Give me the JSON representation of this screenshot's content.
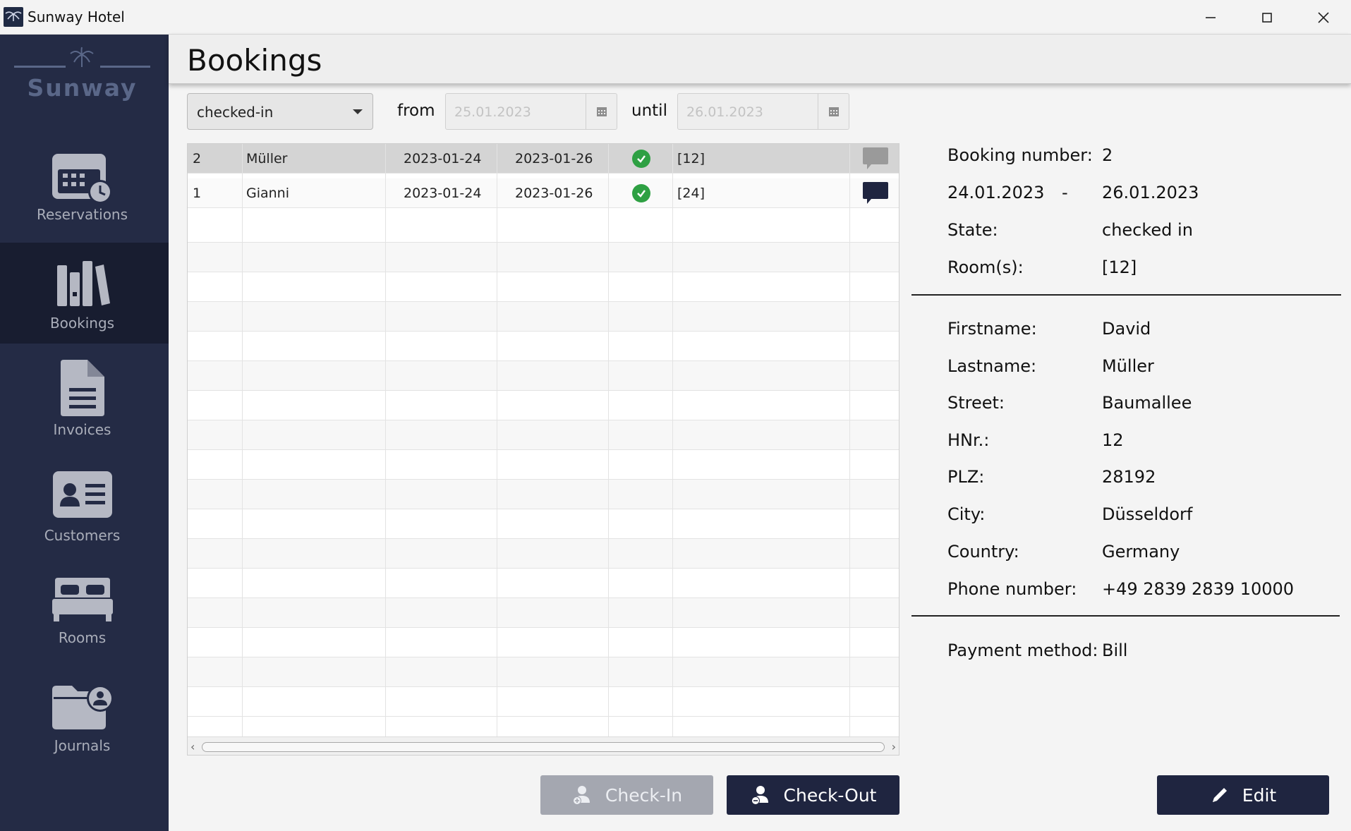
{
  "window": {
    "title": "Sunway Hotel",
    "controls": [
      "minimize",
      "maximize",
      "close"
    ]
  },
  "brand": {
    "name": "Sunway"
  },
  "sidebar": {
    "items": [
      {
        "label": "Reservations",
        "icon": "calendar-clock-icon",
        "active": false
      },
      {
        "label": "Bookings",
        "icon": "books-icon",
        "active": true
      },
      {
        "label": "Invoices",
        "icon": "document-icon",
        "active": false
      },
      {
        "label": "Customers",
        "icon": "id-card-icon",
        "active": false
      },
      {
        "label": "Rooms",
        "icon": "bed-icon",
        "active": false
      },
      {
        "label": "Journals",
        "icon": "folder-user-icon",
        "active": false
      }
    ]
  },
  "header": {
    "title": "Bookings"
  },
  "filters": {
    "state": "checked-in",
    "from_label": "from",
    "from_value": "25.01.2023",
    "until_label": "until",
    "until_value": "26.01.2023"
  },
  "table": {
    "rows": [
      {
        "id": "2",
        "name": "Müller",
        "from": "2023-01-24",
        "until": "2023-01-26",
        "checked": true,
        "rooms": "[12]",
        "comment": "light",
        "selected": true
      },
      {
        "id": "1",
        "name": "Gianni",
        "from": "2023-01-24",
        "until": "2023-01-26",
        "checked": true,
        "rooms": "[24]",
        "comment": "dark",
        "selected": false
      }
    ]
  },
  "details": {
    "booking_number_label": "Booking number:",
    "booking_number": "2",
    "date_from": "24.01.2023",
    "date_dash": "-",
    "date_until": "26.01.2023",
    "state_label": "State:",
    "state": "checked in",
    "rooms_label": "Room(s):",
    "rooms": "[12]",
    "firstname_label": "Firstname:",
    "firstname": "David",
    "lastname_label": "Lastname:",
    "lastname": "Müller",
    "street_label": "Street:",
    "street": "Baumallee",
    "hnr_label": "HNr.:",
    "hnr": "12",
    "plz_label": "PLZ:",
    "plz": "28192",
    "city_label": "City:",
    "city": "Düsseldorf",
    "country_label": "Country:",
    "country": "Germany",
    "phone_label": "Phone number:",
    "phone": "+49 2839 2839 10000",
    "payment_label": "Payment method:",
    "payment": "Bill"
  },
  "actions": {
    "checkin_label": "Check-In",
    "checkout_label": "Check-Out",
    "edit_label": "Edit"
  },
  "colors": {
    "sidebar": "#242b45",
    "sidebar_active": "#181d30",
    "primary_button": "#1f2540",
    "check_green": "#2ea043"
  }
}
